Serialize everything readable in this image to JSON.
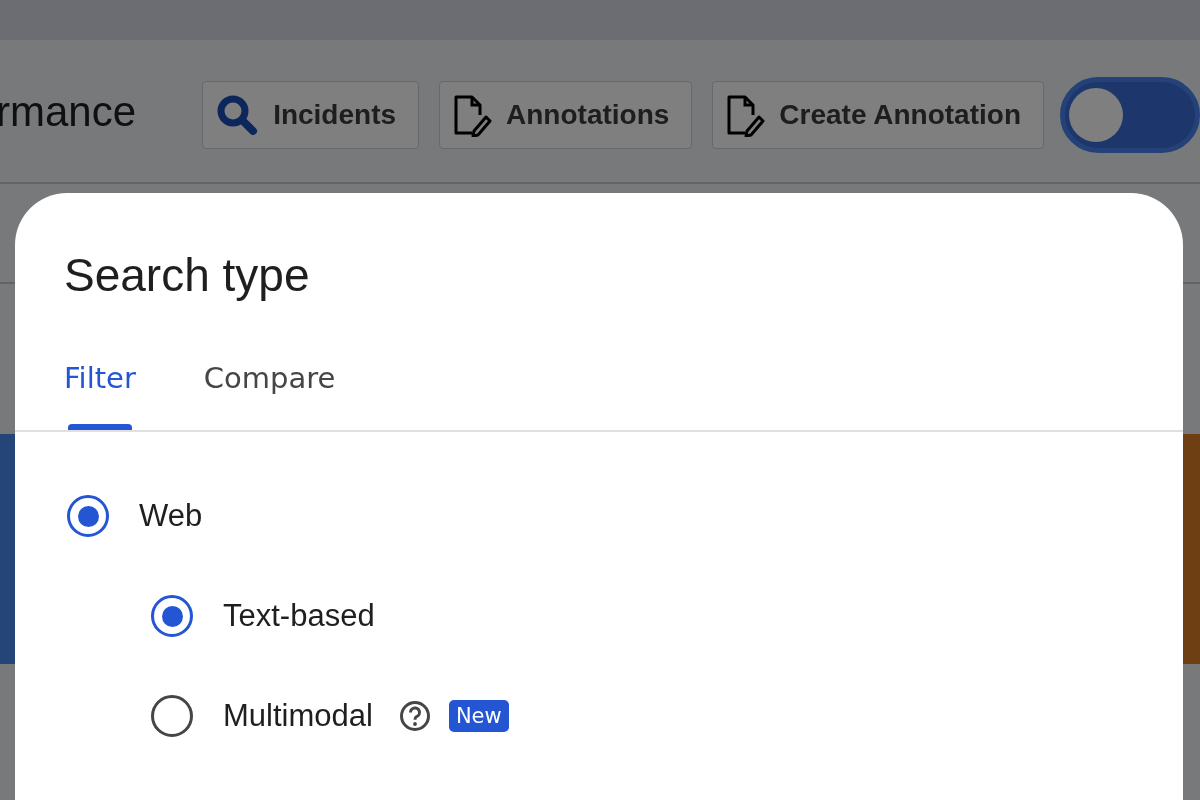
{
  "page": {
    "title": "rmance",
    "buttons": [
      {
        "label": "Incidents",
        "kind": "search"
      },
      {
        "label": "Annotations",
        "kind": "note"
      },
      {
        "label": "Create Annotation",
        "kind": "note"
      }
    ],
    "toggle": {
      "on": false
    }
  },
  "dialog": {
    "title": "Search type",
    "tabs": [
      {
        "label": "Filter",
        "selected": true
      },
      {
        "label": "Compare",
        "selected": false
      }
    ],
    "options": [
      {
        "label": "Web",
        "selected": true,
        "children": [
          {
            "label": "Text-based",
            "selected": true
          },
          {
            "label": "Multimodal",
            "selected": false,
            "help": true,
            "badge": "New"
          }
        ]
      }
    ]
  }
}
